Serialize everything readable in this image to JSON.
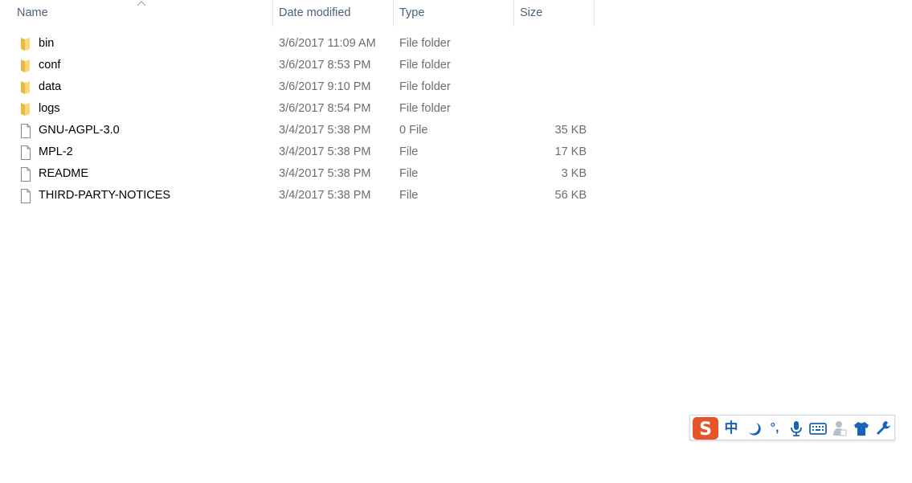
{
  "columns": {
    "name": "Name",
    "date_modified": "Date modified",
    "type": "Type",
    "size": "Size"
  },
  "files": [
    {
      "icon": "folder-icon",
      "name": "bin",
      "date": "3/6/2017 11:09 AM",
      "type": "File folder",
      "size": ""
    },
    {
      "icon": "folder-icon",
      "name": "conf",
      "date": "3/6/2017 8:53 PM",
      "type": "File folder",
      "size": ""
    },
    {
      "icon": "folder-icon",
      "name": "data",
      "date": "3/6/2017 9:10 PM",
      "type": "File folder",
      "size": ""
    },
    {
      "icon": "folder-icon",
      "name": "logs",
      "date": "3/6/2017 8:54 PM",
      "type": "File folder",
      "size": ""
    },
    {
      "icon": "file-icon",
      "name": "GNU-AGPL-3.0",
      "date": "3/4/2017 5:38 PM",
      "type": "0 File",
      "size": "35 KB"
    },
    {
      "icon": "file-icon",
      "name": "MPL-2",
      "date": "3/4/2017 5:38 PM",
      "type": "File",
      "size": "17 KB"
    },
    {
      "icon": "file-icon",
      "name": "README",
      "date": "3/4/2017 5:38 PM",
      "type": "File",
      "size": "3 KB"
    },
    {
      "icon": "file-icon",
      "name": "THIRD-PARTY-NOTICES",
      "date": "3/4/2017 5:38 PM",
      "type": "File",
      "size": "56 KB"
    }
  ],
  "ime_toolbar": {
    "logo_letter": "S",
    "mode_char": "中",
    "punct_char": "°,",
    "icons": [
      "sogou-logo-icon",
      "chinese-mode-icon",
      "moon-icon",
      "punctuation-icon",
      "microphone-icon",
      "keyboard-icon",
      "user-icon",
      "shirt-icon",
      "wrench-icon"
    ]
  },
  "colors": {
    "header_text": "#4c607a",
    "detail_text": "#6d6d6d",
    "folder": "#f8d775",
    "ime_blue": "#1764b6",
    "ime_logo": "#e8542a"
  }
}
